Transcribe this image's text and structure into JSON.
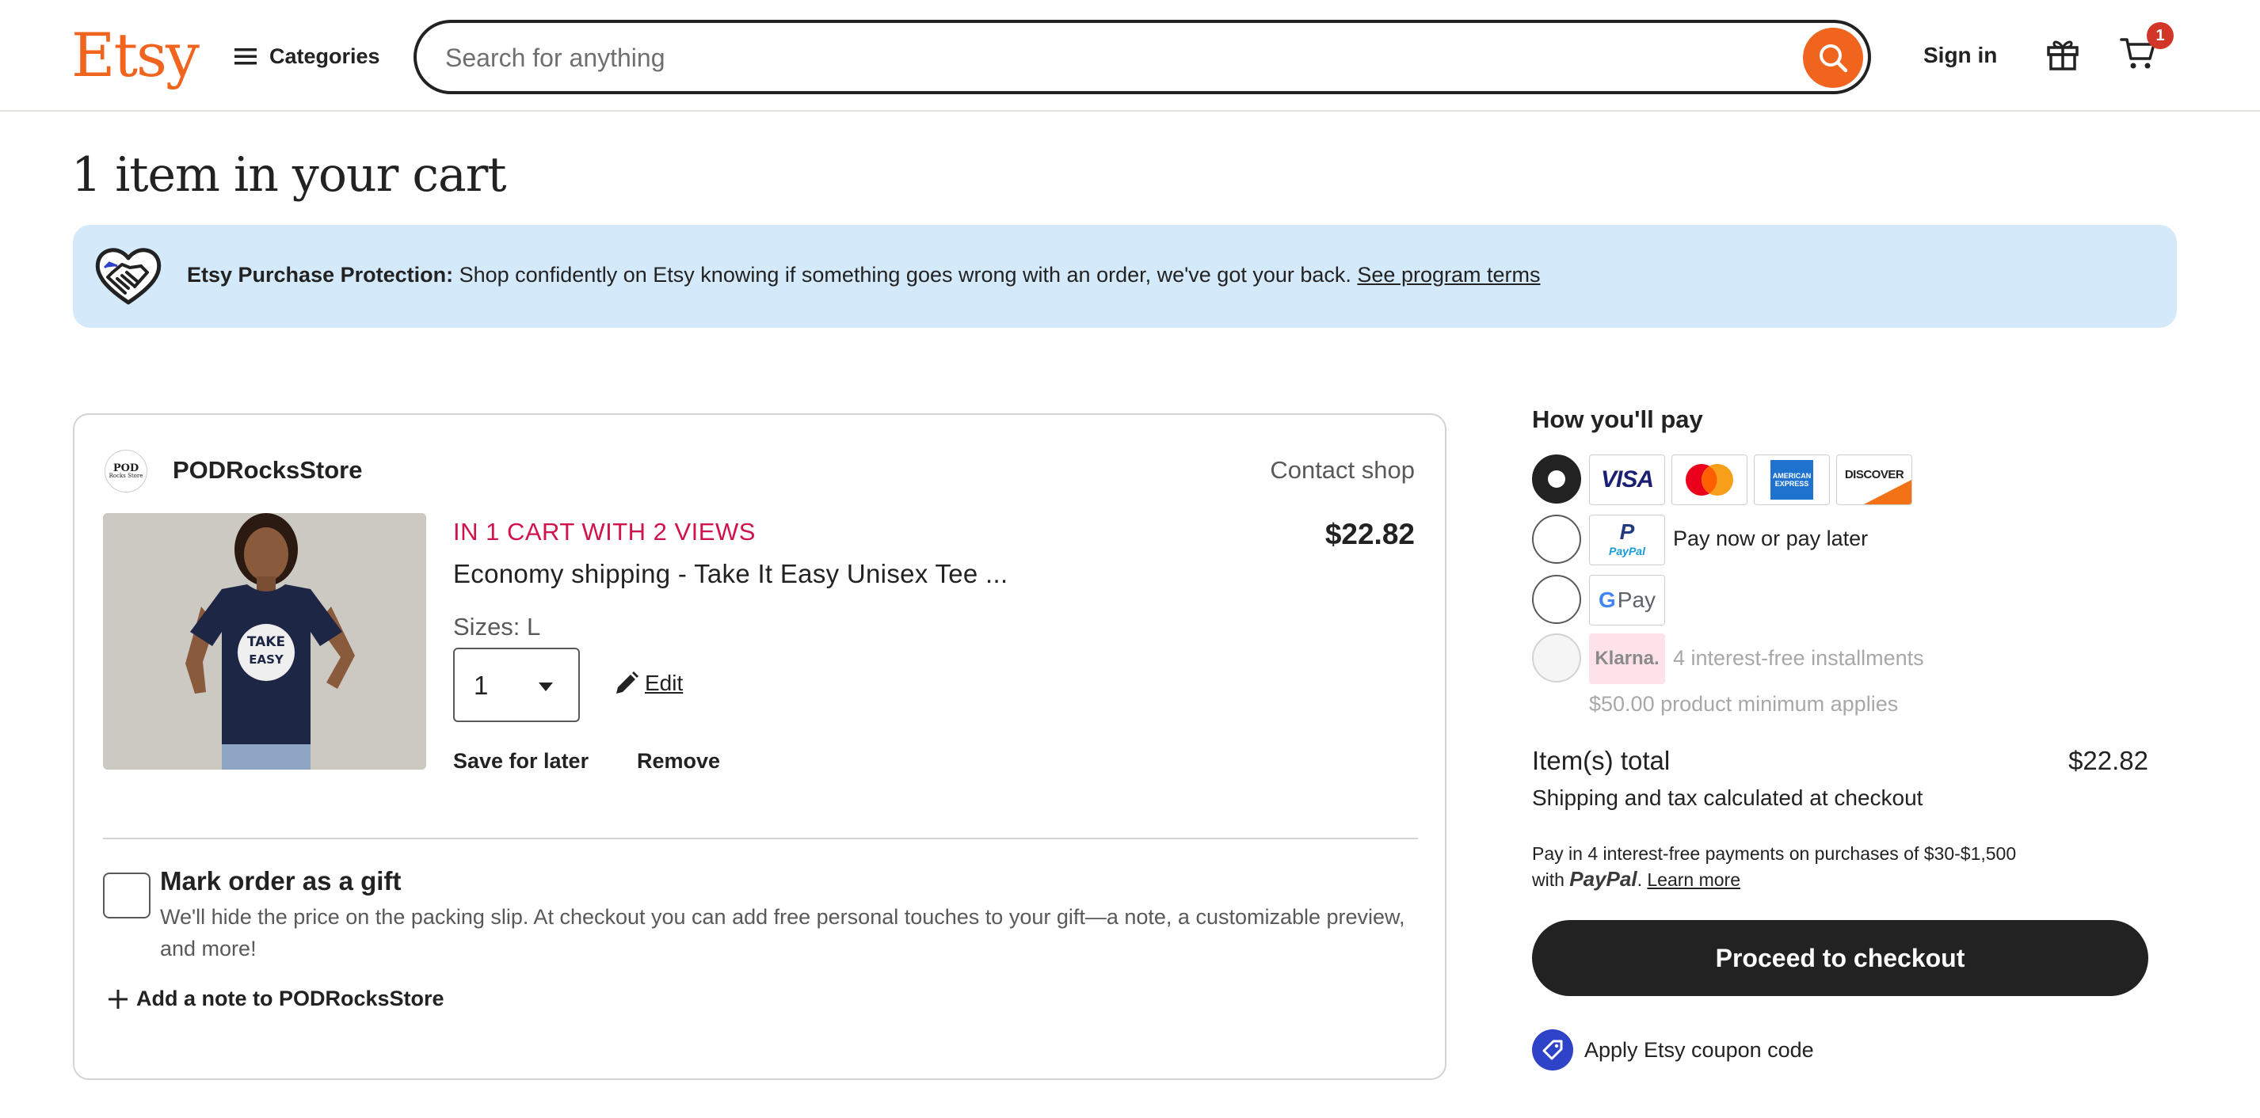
{
  "header": {
    "logo": "Etsy",
    "categories_label": "Categories",
    "search_placeholder": "Search for anything",
    "signin_label": "Sign in",
    "cart_count": "1"
  },
  "page": {
    "title": "1 item in your cart"
  },
  "protection": {
    "bold_label": "Etsy Purchase Protection:",
    "text": " Shop confidently on Etsy knowing if something goes wrong with an order, we've got your back. ",
    "link": "See program terms"
  },
  "shop": {
    "avatar_line1": "POD",
    "avatar_line2": "Rocks Store",
    "name": "PODRocksStore",
    "contact_label": "Contact shop",
    "item": {
      "demand_badge": "IN 1 CART WITH 2 VIEWS",
      "title": "Economy shipping - Take It Easy Unisex Tee ...",
      "price": "$22.82",
      "sizes": "Sizes: L",
      "quantity": "1",
      "edit_label": "Edit",
      "save_later_label": "Save for later",
      "remove_label": "Remove"
    },
    "gift": {
      "title": "Mark order as a gift",
      "description": "We'll hide the price on the packing slip. At checkout you can add free personal touches to your gift—a note, a customizable preview, and more!"
    },
    "add_note_label": "Add a note to PODRocksStore"
  },
  "payment": {
    "title": "How you'll pay",
    "selected": "card",
    "cards": {
      "visa": "VISA",
      "amex_line1": "AMERICAN",
      "amex_line2": "EXPRESS",
      "discover": "DISCOVER"
    },
    "paypal": {
      "logo_letter": "P",
      "logo_text": "PayPal",
      "label": "Pay now or pay later"
    },
    "gpay": {
      "g": "G",
      "pay": "Pay"
    },
    "klarna": {
      "logo": "Klarna.",
      "label": "4 interest-free installments",
      "minimum": "$50.00 product minimum applies"
    }
  },
  "summary": {
    "total_label": "Item(s) total",
    "total_value": "$22.82",
    "shipping_tax": "Shipping and tax calculated at checkout",
    "paypal_note_1": "Pay in 4 interest-free payments on purchases of $30-$1,500",
    "paypal_note_with": "with ",
    "paypal_note_brand": "PayPal",
    "paypal_note_dot": ". ",
    "paypal_note_link": "Learn more",
    "checkout_label": "Proceed to checkout",
    "coupon_label": "Apply Etsy coupon code"
  },
  "colors": {
    "brand_orange": "#f1641e",
    "protection_bg": "#d4e9fa",
    "demand_red": "#d0134b",
    "checkout_bg": "#222222",
    "coupon_blue": "#2f43c9",
    "cart_badge": "#d13628"
  },
  "icons": [
    "hamburger-icon",
    "search-icon",
    "gift-icon",
    "cart-icon",
    "handshake-heart-icon",
    "pencil-icon",
    "plus-icon",
    "tag-icon",
    "chevron-down-icon"
  ]
}
